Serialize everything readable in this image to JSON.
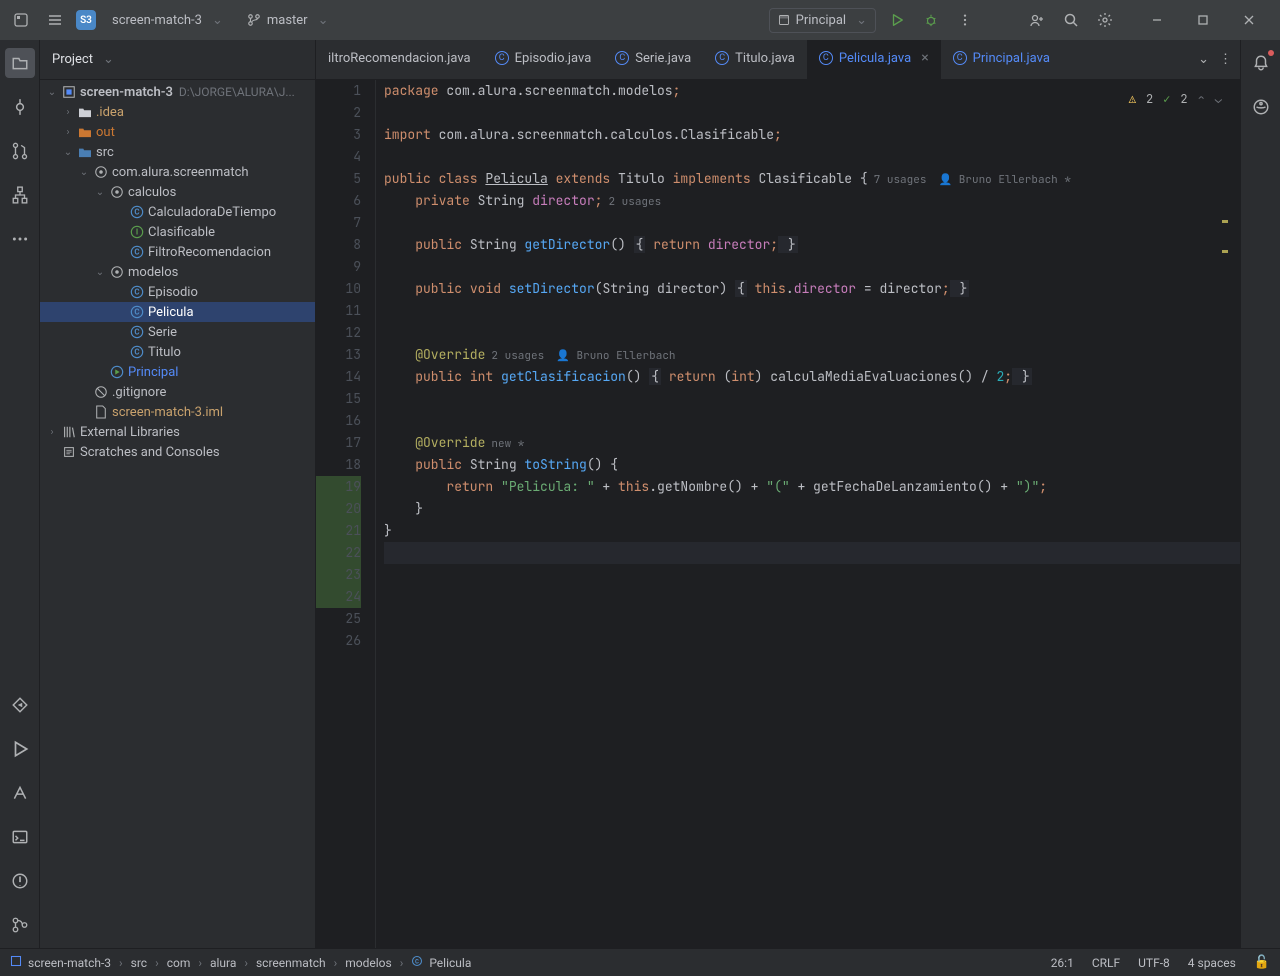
{
  "titlebar": {
    "project_badge": "S3",
    "project_name": "screen-match-3",
    "vcs_branch": "master",
    "run_config": "Principal"
  },
  "project_panel": {
    "title": "Project",
    "root_name": "screen-match-3",
    "root_path": "D:\\JORGE\\ALURA\\J...",
    "nodes": {
      "idea": ".idea",
      "out": "out",
      "src": "src",
      "pkg": "com.alura.screenmatch",
      "calculos": "calculos",
      "calc_tiempo": "CalculadoraDeTiempo",
      "clasificable": "Clasificable",
      "filtro": "FiltroRecomendacion",
      "modelos": "modelos",
      "episodio": "Episodio",
      "pelicula": "Pelicula",
      "serie": "Serie",
      "titulo": "Titulo",
      "principal": "Principal",
      "gitignore": ".gitignore",
      "iml": "screen-match-3.iml",
      "external": "External Libraries",
      "scratches": "Scratches and Consoles"
    }
  },
  "tabs": {
    "t0": "iltroRecomendacion.java",
    "t1": "Episodio.java",
    "t2": "Serie.java",
    "t3": "Titulo.java",
    "t4": "Pelicula.java",
    "t5": "Principal.java"
  },
  "editor": {
    "usages_7": "7 usages",
    "author1": "Bruno Ellerbach *",
    "usages_2": "2 usages",
    "usages_2b": "2 usages",
    "author2": "Bruno Ellerbach",
    "new_hint": "new *",
    "l1_a": "package",
    "l1_b": " com.alura.screenmatch.modelos",
    "l1_c": ";",
    "l3_a": "import",
    "l3_b": " com.alura.screenmatch.calculos.Clasificable",
    "l3_c": ";",
    "l5_a": "public class ",
    "l5_b": "Pelicula",
    "l5_c": " extends ",
    "l5_d": "Titulo",
    "l5_e": " implements ",
    "l5_f": "Clasificable",
    "l5_g": " {",
    "l6_a": "    private ",
    "l6_b": "String ",
    "l6_c": "director",
    "l6_d": ";",
    "l8_a": "    public ",
    "l8_b": "String ",
    "l8_c": "getDirector",
    "l8_d": "() ",
    "l8_e": "{",
    "l8_f": " return ",
    "l8_g": "director",
    "l8_h": ";",
    "l8_i": " }",
    "l10_a": "    public ",
    "l10_b": "void ",
    "l10_c": "setDirector",
    "l10_d": "(String director) ",
    "l10_e": "{",
    "l10_f": " this",
    "l10_g": ".",
    "l10_h": "director",
    "l10_i": " = director",
    "l10_j": ";",
    "l10_k": " }",
    "l13_a": "    @Override",
    "l14_a": "    public ",
    "l14_b": "int ",
    "l14_c": "getClasificacion",
    "l14_d": "() ",
    "l14_e": "{",
    "l14_f": " return ",
    "l14_g": "(",
    "l14_h": "int",
    "l14_i": ") calculaMediaEvaluaciones() / ",
    "l14_j": "2",
    "l14_k": ";",
    "l14_l": " }",
    "l17_a": "    @Override",
    "l18_a": "    public ",
    "l18_b": "String ",
    "l18_c": "toString",
    "l18_d": "() {",
    "l19_a": "        return ",
    "l19_b": "\"Pelicula: \"",
    "l19_c": " + ",
    "l19_d": "this",
    "l19_e": ".getNombre() + ",
    "l19_f": "\"(\"",
    "l19_g": " + getFechaDeLanzamiento() + ",
    "l19_h": "\")\"",
    "l19_i": ";",
    "l20_a": "    }",
    "l21_a": "}",
    "line_numbers": [
      "1",
      "2",
      "3",
      "4",
      "5",
      "6",
      "7",
      "8",
      "9",
      "10",
      "11",
      "12",
      "13",
      "14",
      "15",
      "16",
      "17",
      "18",
      "19",
      "20",
      "21",
      "22",
      "23",
      "24",
      "25",
      "26"
    ]
  },
  "problems": {
    "warnings": "2",
    "passed": "2"
  },
  "breadcrumb": {
    "b0": "screen-match-3",
    "b1": "src",
    "b2": "com",
    "b3": "alura",
    "b4": "screenmatch",
    "b5": "modelos",
    "b6": "Pelicula"
  },
  "statusbar": {
    "position": "26:1",
    "line_sep": "CRLF",
    "encoding": "UTF-8",
    "indent": "4 spaces"
  }
}
